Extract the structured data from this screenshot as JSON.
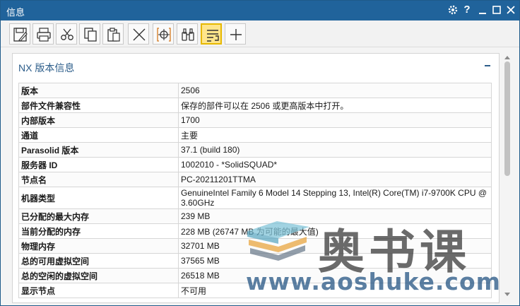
{
  "window": {
    "title": "信息"
  },
  "titlebar_icons": [
    "gear-icon",
    "help-icon",
    "minimize-icon",
    "maximize-icon",
    "close-icon"
  ],
  "titlebar_glyphs": {
    "help": "?"
  },
  "toolbar": {
    "buttons": [
      {
        "name": "save-icon"
      },
      {
        "name": "print-icon"
      },
      {
        "name": "cut-icon"
      },
      {
        "name": "copy-icon"
      },
      {
        "name": "paste-icon"
      },
      {
        "name": "delete-icon"
      },
      {
        "name": "crosshair-icon"
      },
      {
        "name": "binoculars-icon"
      },
      {
        "name": "wrap-text-icon",
        "active": true
      },
      {
        "name": "add-icon"
      }
    ]
  },
  "panel": {
    "title": "NX 版本信息",
    "rows": [
      {
        "key": "版本",
        "value": "2506"
      },
      {
        "key": "部件文件兼容性",
        "value": "保存的部件可以在 2506 或更高版本中打开。"
      },
      {
        "key": "内部版本",
        "value": "1700"
      },
      {
        "key": "通道",
        "value": "主要"
      },
      {
        "key": "Parasolid 版本",
        "value": "37.1 (build 180)"
      },
      {
        "key": "服务器 ID",
        "value": "1002010 - *SolidSQUAD*"
      },
      {
        "key": "节点名",
        "value": "PC-20211201TTMA"
      },
      {
        "key": "机器类型",
        "value": "GenuineIntel Family 6 Model 14 Stepping 13, Intel(R) Core(TM) i7-9700K CPU @ 3.60GHz"
      },
      {
        "key": "已分配的最大内存",
        "value": "239 MB"
      },
      {
        "key": "当前分配的内存",
        "value": "228 MB (26747 MB 为可能的最大值)"
      },
      {
        "key": "物理内存",
        "value": "32701 MB"
      },
      {
        "key": "总的可用虚拟空间",
        "value": "37565 MB"
      },
      {
        "key": "总的空闲的虚拟空间",
        "value": "26518 MB"
      },
      {
        "key": "显示节点",
        "value": "不可用"
      }
    ]
  },
  "watermark": {
    "brand": "奥书课",
    "url": "www.aoshuke.com"
  },
  "colors": {
    "titlebar": "#20639b",
    "panel_title": "#2c5d8a",
    "active_tool": "#ffe58a"
  }
}
